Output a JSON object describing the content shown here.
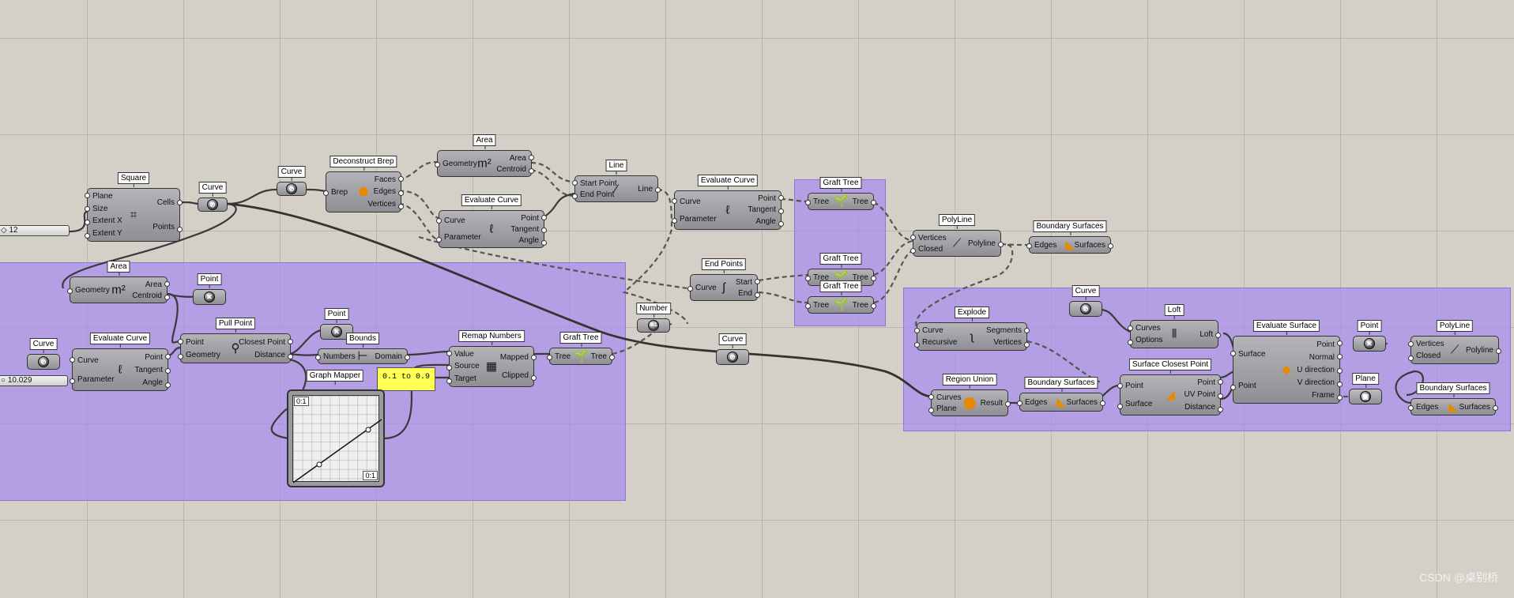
{
  "watermark": "CSDN @桌别桥",
  "slider_count": "◇ 12",
  "slider_param": "○ 10.029",
  "remap_range": "0.1 to 0.9",
  "graph": {
    "title": "Graph Mapper",
    "corner_tl": "0:1",
    "corner_br": "0:1"
  },
  "components": [
    {
      "title": "Square",
      "inputs": [
        "Plane",
        "Size",
        "Extent X",
        "Extent Y"
      ],
      "outputs": [
        "Cells",
        "Points"
      ],
      "icon": "⌗"
    },
    {
      "title": "Curve",
      "icon": "curve-param"
    },
    {
      "title": "Curve",
      "icon": "curve-param"
    },
    {
      "title": "Deconstruct Brep",
      "inputs": [
        "Brep"
      ],
      "outputs": [
        "Faces",
        "Edges",
        "Vertices"
      ],
      "icon": "⬢"
    },
    {
      "title": "Area",
      "inputs": [
        "Geometry"
      ],
      "outputs": [
        "Area",
        "Centroid"
      ],
      "icon": "m²"
    },
    {
      "title": "Evaluate Curve",
      "inputs": [
        "Curve",
        "Parameter"
      ],
      "outputs": [
        "Point",
        "Tangent",
        "Angle"
      ],
      "icon": "ℓ"
    },
    {
      "title": "Line",
      "inputs": [
        "Start Point",
        "End Point"
      ],
      "outputs": [
        "Line"
      ],
      "icon": "⁄"
    },
    {
      "title": "Evaluate Curve",
      "inputs": [
        "Curve",
        "Parameter"
      ],
      "outputs": [
        "Point",
        "Tangent",
        "Angle"
      ],
      "icon": "ℓ"
    },
    {
      "title": "End Points",
      "inputs": [
        "Curve"
      ],
      "outputs": [
        "Start",
        "End"
      ],
      "icon": "∫"
    },
    {
      "title": "Graft Tree",
      "inputs": [
        "Tree"
      ],
      "outputs": [
        "Tree"
      ],
      "icon": "🌱"
    },
    {
      "title": "Graft Tree",
      "inputs": [
        "Tree"
      ],
      "outputs": [
        "Tree"
      ],
      "icon": "🌱"
    },
    {
      "title": "Graft Tree",
      "inputs": [
        "Tree"
      ],
      "outputs": [
        "Tree"
      ],
      "icon": "🌱"
    },
    {
      "title": "PolyLine",
      "inputs": [
        "Vertices",
        "Closed"
      ],
      "outputs": [
        "Polyline"
      ],
      "icon": "⟋"
    },
    {
      "title": "Boundary Surfaces",
      "inputs": [
        "Edges"
      ],
      "outputs": [
        "Surfaces"
      ],
      "icon": "◣"
    },
    {
      "title": "Area",
      "inputs": [
        "Geometry"
      ],
      "outputs": [
        "Area",
        "Centroid"
      ],
      "icon": "m²"
    },
    {
      "title": "Point",
      "icon": "point-param"
    },
    {
      "title": "Curve",
      "icon": "curve-param"
    },
    {
      "title": "Evaluate Curve",
      "inputs": [
        "Curve",
        "Parameter"
      ],
      "outputs": [
        "Point",
        "Tangent",
        "Angle"
      ],
      "icon": "ℓ"
    },
    {
      "title": "Pull Point",
      "inputs": [
        "Point",
        "Geometry"
      ],
      "outputs": [
        "Closest Point",
        "Distance"
      ],
      "icon": "⚲"
    },
    {
      "title": "Point",
      "icon": "point-param"
    },
    {
      "title": "Bounds",
      "inputs": [
        "Numbers"
      ],
      "outputs": [
        "Domain"
      ],
      "icon": "⊢"
    },
    {
      "title": "Remap Numbers",
      "inputs": [
        "Value",
        "Source",
        "Target"
      ],
      "outputs": [
        "Mapped",
        "Clipped"
      ],
      "icon": "▦"
    },
    {
      "title": "Graft Tree",
      "inputs": [
        "Tree"
      ],
      "outputs": [
        "Tree"
      ],
      "icon": "🌱"
    },
    {
      "title": "Number",
      "icon": "0.1"
    },
    {
      "title": "Curve",
      "icon": "curve-param"
    },
    {
      "title": "Explode",
      "inputs": [
        "Curve",
        "Recursive"
      ],
      "outputs": [
        "Segments",
        "Vertices"
      ],
      "icon": "ʅ"
    },
    {
      "title": "Curve",
      "icon": "curve-param"
    },
    {
      "title": "Loft",
      "inputs": [
        "Curves",
        "Options"
      ],
      "outputs": [
        "Loft"
      ],
      "icon": "⦀"
    },
    {
      "title": "Evaluate Surface",
      "inputs": [
        "Surface",
        "Point"
      ],
      "outputs": [
        "Point",
        "Normal",
        "U direction",
        "V direction",
        "Frame"
      ],
      "icon": "◆"
    },
    {
      "title": "Point",
      "icon": "point-param"
    },
    {
      "title": "PolyLine",
      "inputs": [
        "Vertices",
        "Closed"
      ],
      "outputs": [
        "Polyline"
      ],
      "icon": "⟋"
    },
    {
      "title": "Region Union",
      "inputs": [
        "Curves",
        "Plane"
      ],
      "outputs": [
        "Result"
      ],
      "icon": "⬤"
    },
    {
      "title": "Boundary Surfaces",
      "inputs": [
        "Edges"
      ],
      "outputs": [
        "Surfaces"
      ],
      "icon": "◣"
    },
    {
      "title": "Surface Closest Point",
      "inputs": [
        "Point",
        "Surface"
      ],
      "outputs": [
        "Point",
        "UV Point",
        "Distance"
      ],
      "icon": "◢"
    },
    {
      "title": "Plane",
      "icon": "plane-param"
    },
    {
      "title": "Boundary Surfaces",
      "inputs": [
        "Edges"
      ],
      "outputs": [
        "Surfaces"
      ],
      "icon": "◣"
    }
  ]
}
